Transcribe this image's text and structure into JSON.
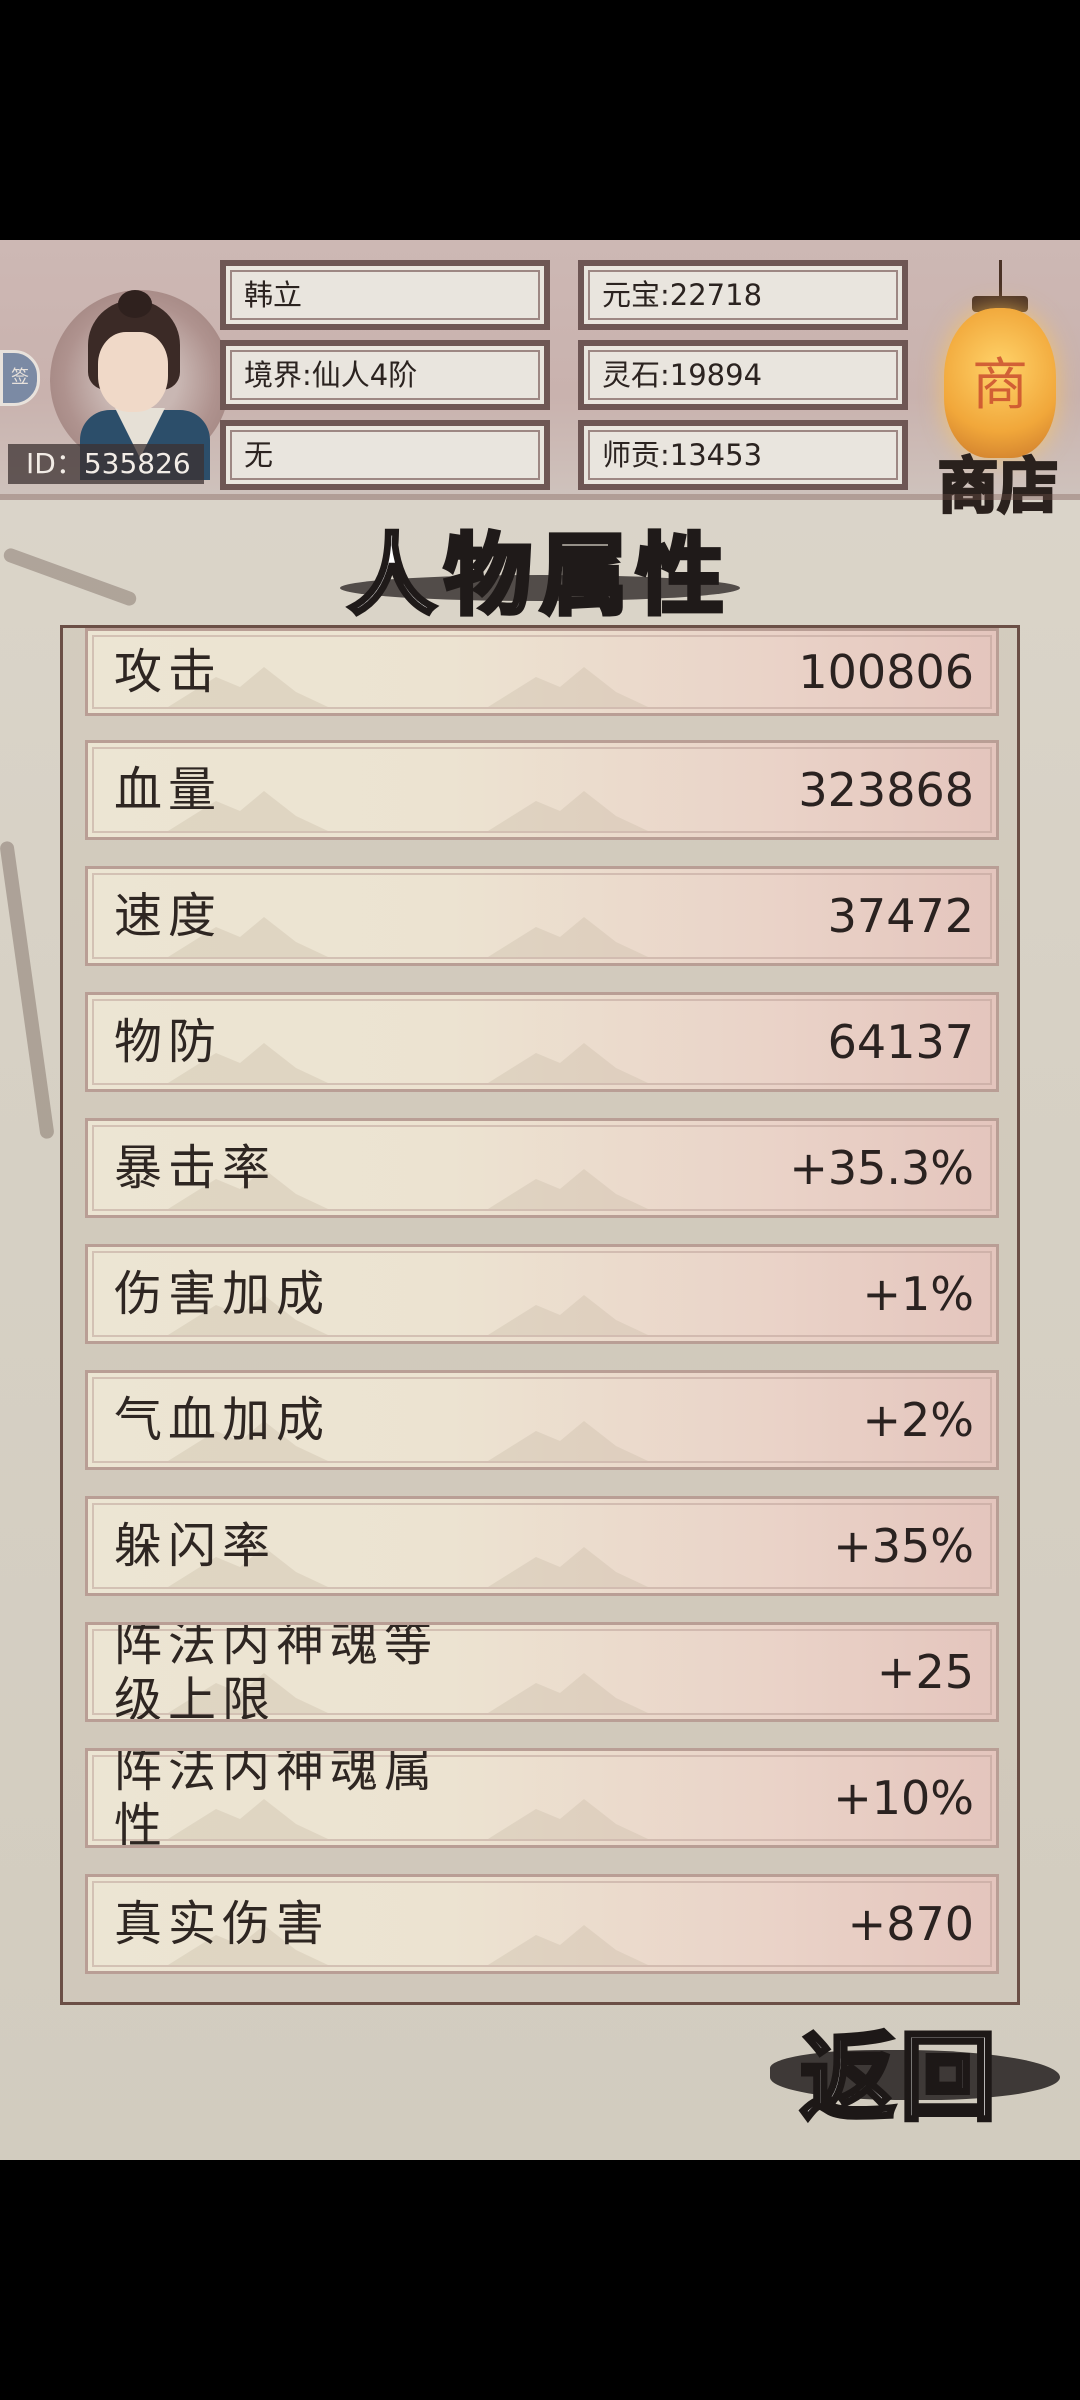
{
  "player": {
    "id_text": "ID：535826",
    "name": "韩立",
    "realm": "境界:仙人4阶",
    "sect": "无",
    "ingot": "元宝:22718",
    "spirit_stone": "灵石:19894",
    "contribution": "师贡:13453"
  },
  "shop": {
    "label": "商店",
    "lantern_char": "商"
  },
  "side_button_text": "签",
  "page_title": "人物属性",
  "stats": [
    {
      "label": "攻击",
      "value": "100806"
    },
    {
      "label": "血量",
      "value": "323868"
    },
    {
      "label": "速度",
      "value": "37472"
    },
    {
      "label": "物防",
      "value": "64137"
    },
    {
      "label": "暴击率",
      "value": "+35.3%"
    },
    {
      "label": "伤害加成",
      "value": "+1%"
    },
    {
      "label": "气血加成",
      "value": "+2%"
    },
    {
      "label": "躲闪率",
      "value": "+35%"
    },
    {
      "label": "阵法内神魂等级上限",
      "value": "+25"
    },
    {
      "label": "阵法内神魂属性",
      "value": "+10%"
    },
    {
      "label": "真实伤害",
      "value": "+870"
    }
  ],
  "back_label": "返回"
}
